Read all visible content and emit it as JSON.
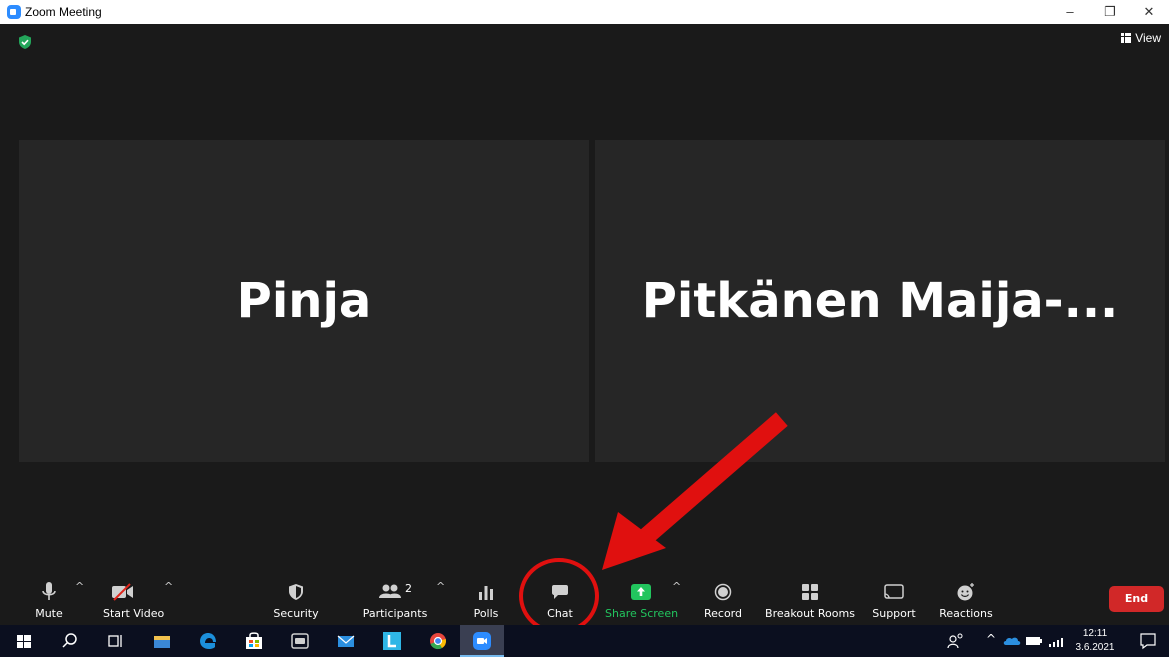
{
  "window": {
    "title": "Zoom Meeting",
    "minimize": "–",
    "restore": "❐",
    "close": "✕"
  },
  "meeting": {
    "view_label": "View",
    "tiles": [
      {
        "name": "Pinja"
      },
      {
        "name": "Pitkänen  Maija-..."
      }
    ]
  },
  "toolbar": {
    "mute": "Mute",
    "start_video": "Start Video",
    "security": "Security",
    "participants": "Participants",
    "participants_count": "2",
    "polls": "Polls",
    "chat": "Chat",
    "share_screen": "Share Screen",
    "record": "Record",
    "breakout_rooms": "Breakout Rooms",
    "support": "Support",
    "reactions": "Reactions",
    "end": "End",
    "caret": "^"
  },
  "taskbar": {
    "time": "12:11",
    "date": "3.6.2021"
  },
  "colors": {
    "accent": "#2d8cff",
    "share_green": "#22c55e",
    "end_red": "#d12828",
    "annotation_red": "#e0100f"
  }
}
